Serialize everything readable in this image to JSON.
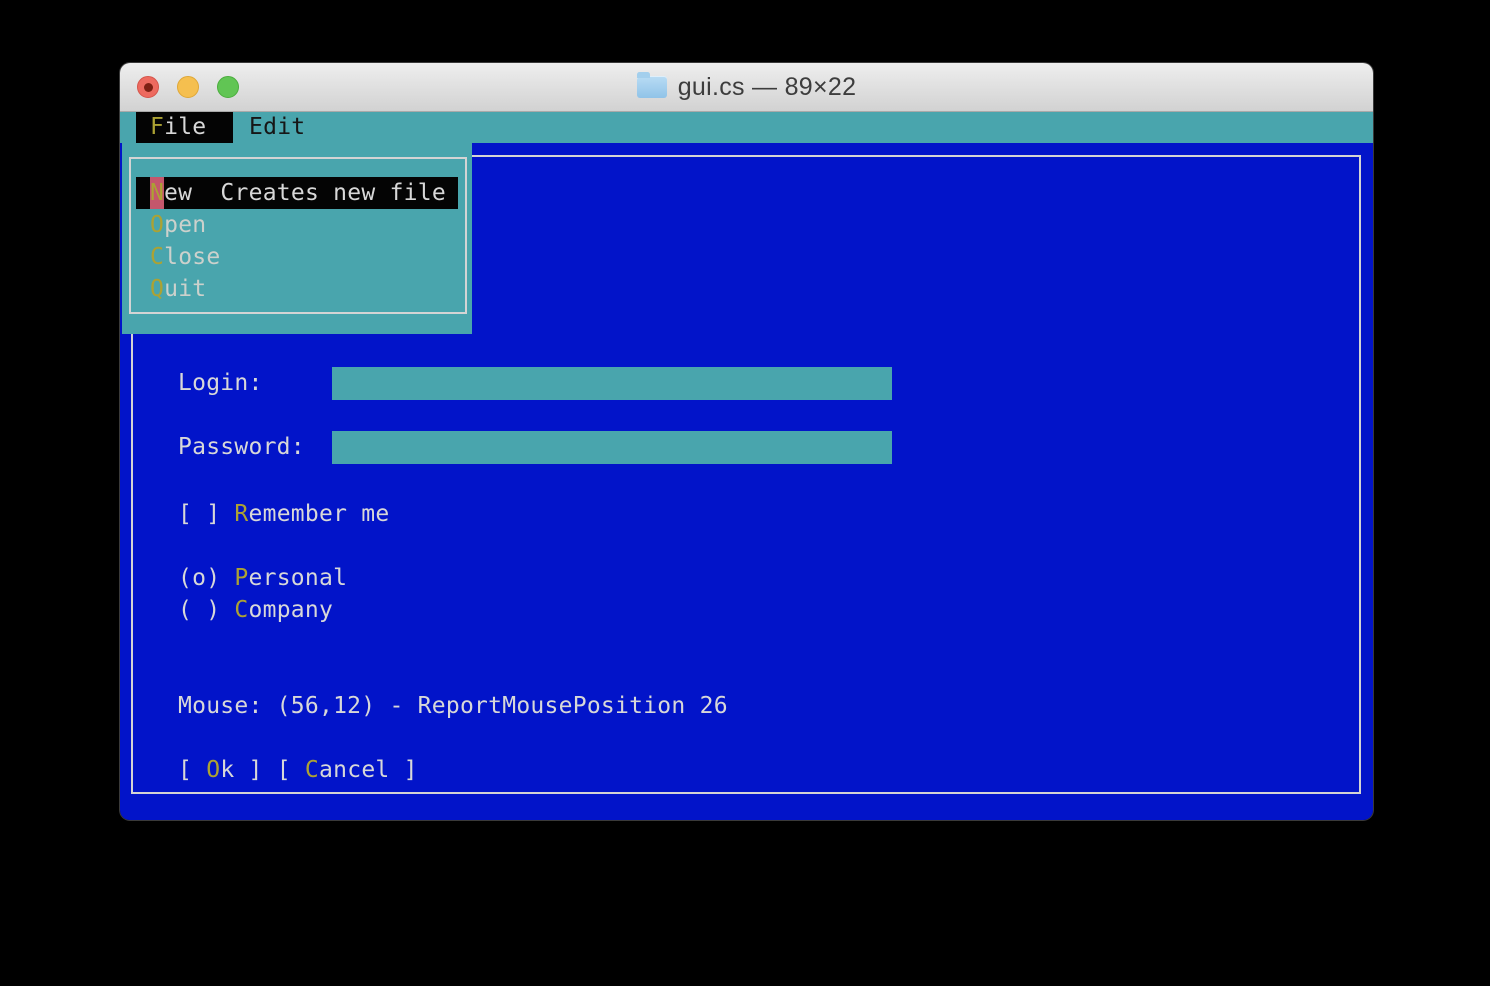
{
  "window": {
    "title": "gui.cs — 89×22"
  },
  "colors": {
    "teal": "#49a5ad",
    "blue": "#0214c9",
    "hot_yellow": "#aca233",
    "text_light": "#d8d8d8",
    "menu_item_text": "#ccd1cc",
    "selected_bg": "#040404",
    "cursor_pink": "#c4576c",
    "border_white": "#d4d4d4"
  },
  "menubar": {
    "file": {
      "hot": "F",
      "rest": "ile"
    },
    "edit": {
      "label": "Edit"
    }
  },
  "file_menu": {
    "items": [
      {
        "hot": "N",
        "rest": "ew",
        "help": "  Creates new file"
      },
      {
        "hot": "O",
        "rest": "pen"
      },
      {
        "hot": "C",
        "rest": "lose"
      },
      {
        "hot": "Q",
        "rest": "uit"
      }
    ]
  },
  "form": {
    "login_label": "Login:",
    "login_value": "",
    "password_label": "Password:",
    "password_value": "",
    "remember": {
      "pre": "[ ] ",
      "hot": "R",
      "rest": "emember me"
    },
    "radio_personal": {
      "pre": "(o) ",
      "hot": "P",
      "rest": "ersonal"
    },
    "radio_company": {
      "pre": "( ) ",
      "hot": "C",
      "rest": "ompany"
    },
    "status": "Mouse: (56,12) - ReportMousePosition 26",
    "ok": {
      "pre": "[ ",
      "hot": "O",
      "rest": "k ]"
    },
    "cancel": {
      "pre": "[ ",
      "hot": "C",
      "rest": "ancel ]"
    }
  }
}
